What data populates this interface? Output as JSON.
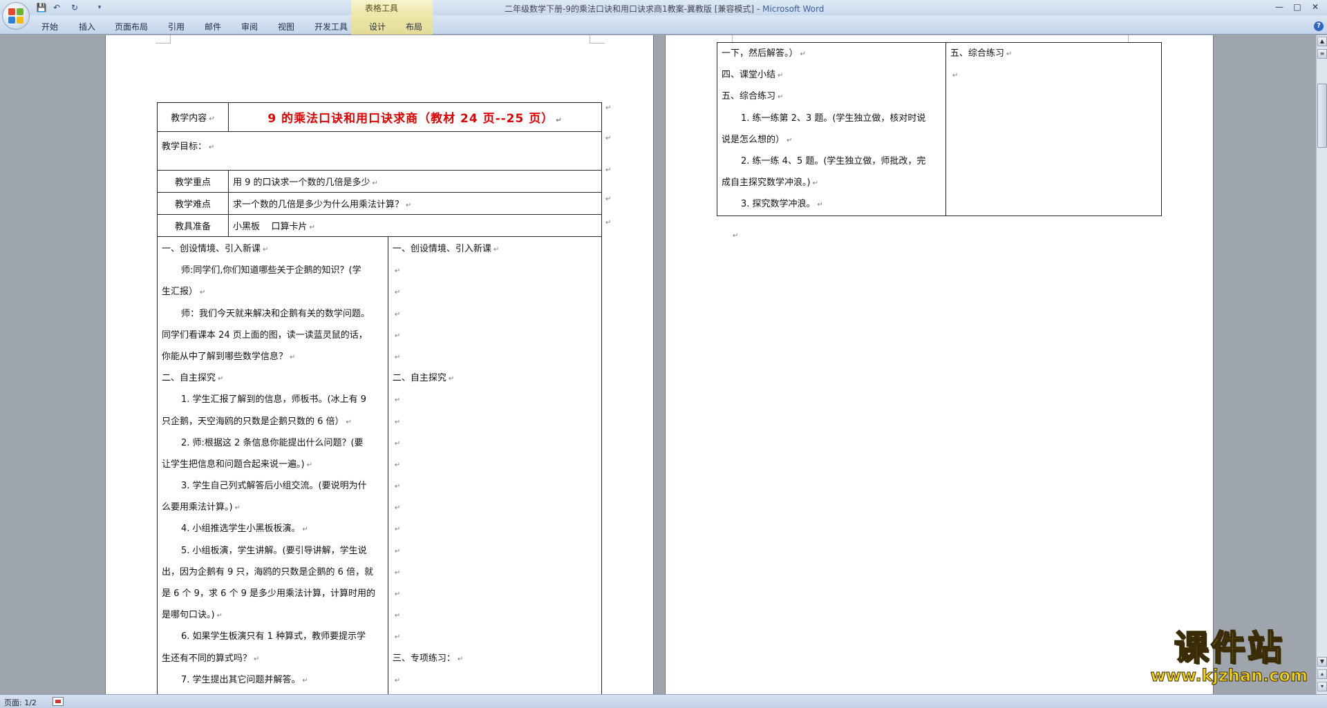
{
  "window": {
    "title": "二年级数学下册-9的乘法口诀和用口诀求商1教案-冀教版 [兼容模式]",
    "app": "Microsoft Word",
    "minimize": "—",
    "maximize": "□",
    "close": "✕"
  },
  "quick_access": {
    "save": "💾",
    "undo": "↶",
    "redo": "↻",
    "more": "▾"
  },
  "contextual_group": "表格工具",
  "ribbon_tabs": [
    "开始",
    "插入",
    "页面布局",
    "引用",
    "邮件",
    "审阅",
    "视图",
    "开发工具",
    "设计",
    "布局"
  ],
  "help": "?",
  "page1": {
    "header": {
      "label": "教学内容",
      "title": "9 的乘法口诀和用口诀求商（教材 24 页--25 页）"
    },
    "goal_label": "教学目标：",
    "rows": [
      {
        "label": "教学重点",
        "value": "用 9 的口诀求一个数的几倍是多少"
      },
      {
        "label": "教学难点",
        "value": "求一个数的几倍是多少为什么用乘法计算？"
      },
      {
        "label": "教具准备",
        "value": "小黑板    口算卡片"
      }
    ],
    "left_lines": [
      "一、创设情境、引入新课",
      "师:同学们,你们知道哪些关于企鹅的知识？(学",
      "生汇报）",
      "师：我们今天就来解决和企鹅有关的数学问题。",
      "同学们看课本 24 页上面的图，读一读蓝灵鼠的话，",
      "你能从中了解到哪些数学信息？",
      "二、自主探究",
      "1. 学生汇报了解到的信息，师板书。(冰上有 9",
      "只企鹅，天空海鸥的只数是企鹅只数的 6 倍）",
      "2. 师:根据这 2 条信息你能提出什么问题？(要",
      "让学生把信息和问题合起来说一遍。)",
      "3. 学生自己列式解答后小组交流。(要说明为什",
      "么要用乘法计算。)",
      "4. 小组推选学生小黑板板演。",
      "5. 小组板演，学生讲解。(要引导讲解，学生说",
      "出，因为企鹅有 9 只，海鸥的只数是企鹅的 6 倍，就",
      "是 6 个 9，求 6 个 9 是多少用乘法计算，计算时用的",
      "是哪句口诀。)",
      "6. 如果学生板演只有 1 种算式，教师要提示学",
      "生还有不同的算式吗？",
      "7. 学生提出其它问题并解答。"
    ],
    "right_lines": [
      "一、创设情境、引入新课",
      "",
      "",
      "",
      "",
      "",
      "二、自主探究",
      "",
      "",
      "",
      "",
      "",
      "",
      "",
      "",
      "",
      "",
      "",
      "",
      "三、专项练习：",
      ""
    ]
  },
  "page2": {
    "left_lines": [
      "一下，然后解答。）",
      "四、课堂小结",
      "五、综合练习",
      "1. 练一练第 2、3 题。(学生独立做，核对时说",
      "说是怎么想的）",
      "2. 练一练 4、5 题。(学生独立做，师批改，完",
      "成自主探究数学冲浪。)",
      "3. 探究数学冲浪。"
    ],
    "right_lines": [
      "五、综合练习",
      ""
    ]
  },
  "status": {
    "page": "页面: 1/2"
  },
  "watermark": {
    "main": "课件站",
    "url": "www.kjzhan.com"
  },
  "colors": {
    "title_red": "#e00000",
    "ribbon_bg": "#c9d9ed",
    "workspace": "#9ea5ad",
    "context_tab": "#f3e79a"
  }
}
